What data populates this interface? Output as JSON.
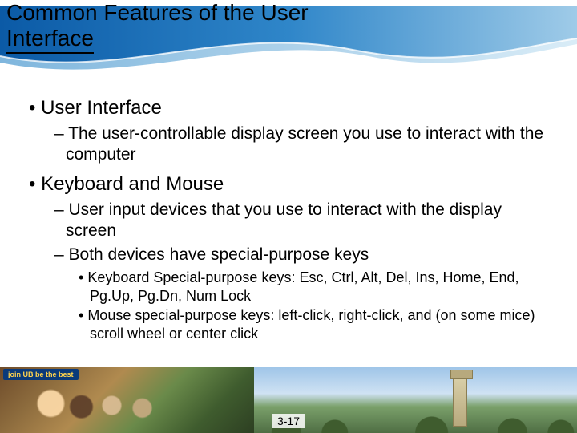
{
  "title_line1": "Common Features of the User",
  "title_line2": "Interface",
  "bullets": {
    "b1": "User Interface",
    "b1_1": "The user-controllable display screen you use to interact with the computer",
    "b2": "Keyboard and Mouse",
    "b2_1": "User input devices that you use to interact with the display screen",
    "b2_2": "Both devices have special-purpose keys",
    "b2_2_1": "Keyboard Special-purpose keys: Esc, Ctrl, Alt, Del, Ins, Home, End, Pg.Up, Pg.Dn, Num Lock",
    "b2_2_2": "Mouse special-purpose keys: left-click, right-click, and (on some mice) scroll wheel or center click"
  },
  "footer_banner": "join UB be the best",
  "slide_number": "3-17"
}
